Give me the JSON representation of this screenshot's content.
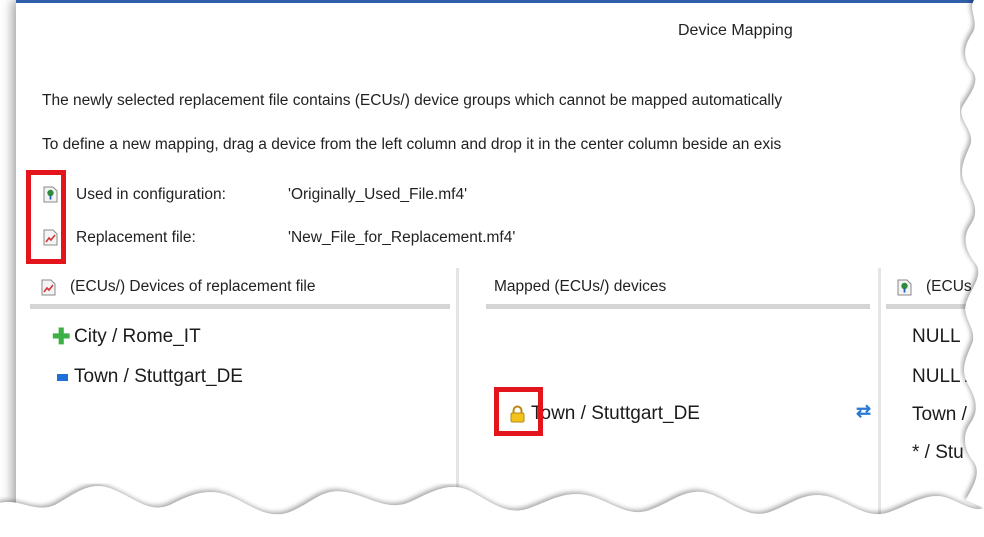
{
  "dialog": {
    "title": "Device Mapping",
    "message_line1": "The newly selected replacement file contains (ECUs/) device groups which cannot be mapped automatically",
    "message_line2": "To define a new mapping, drag a device from the left column and drop it in the center column beside an exis"
  },
  "info": {
    "used_label": "Used in configuration:",
    "used_value": "'Originally_Used_File.mf4'",
    "replacement_label": "Replacement file:",
    "replacement_value": "'New_File_for_Replacement.mf4'"
  },
  "columns": {
    "left_header": "(ECUs/) Devices of replacement file",
    "center_header": "Mapped (ECUs/) devices",
    "right_header": "(ECUs"
  },
  "left_items": [
    "City / Rome_IT",
    "Town / Stuttgart_DE"
  ],
  "center_items": [
    "Town / Stuttgart_DE"
  ],
  "right_items": [
    "NULL",
    "NULL /",
    "Town /",
    "* / Stu"
  ],
  "colors": {
    "highlight": "#e3141b",
    "accent": "#2f5fa8"
  },
  "icons": [
    "config-file-icon",
    "replacement-file-icon",
    "plus-icon",
    "device-icon",
    "lock-icon",
    "refresh-icon"
  ]
}
